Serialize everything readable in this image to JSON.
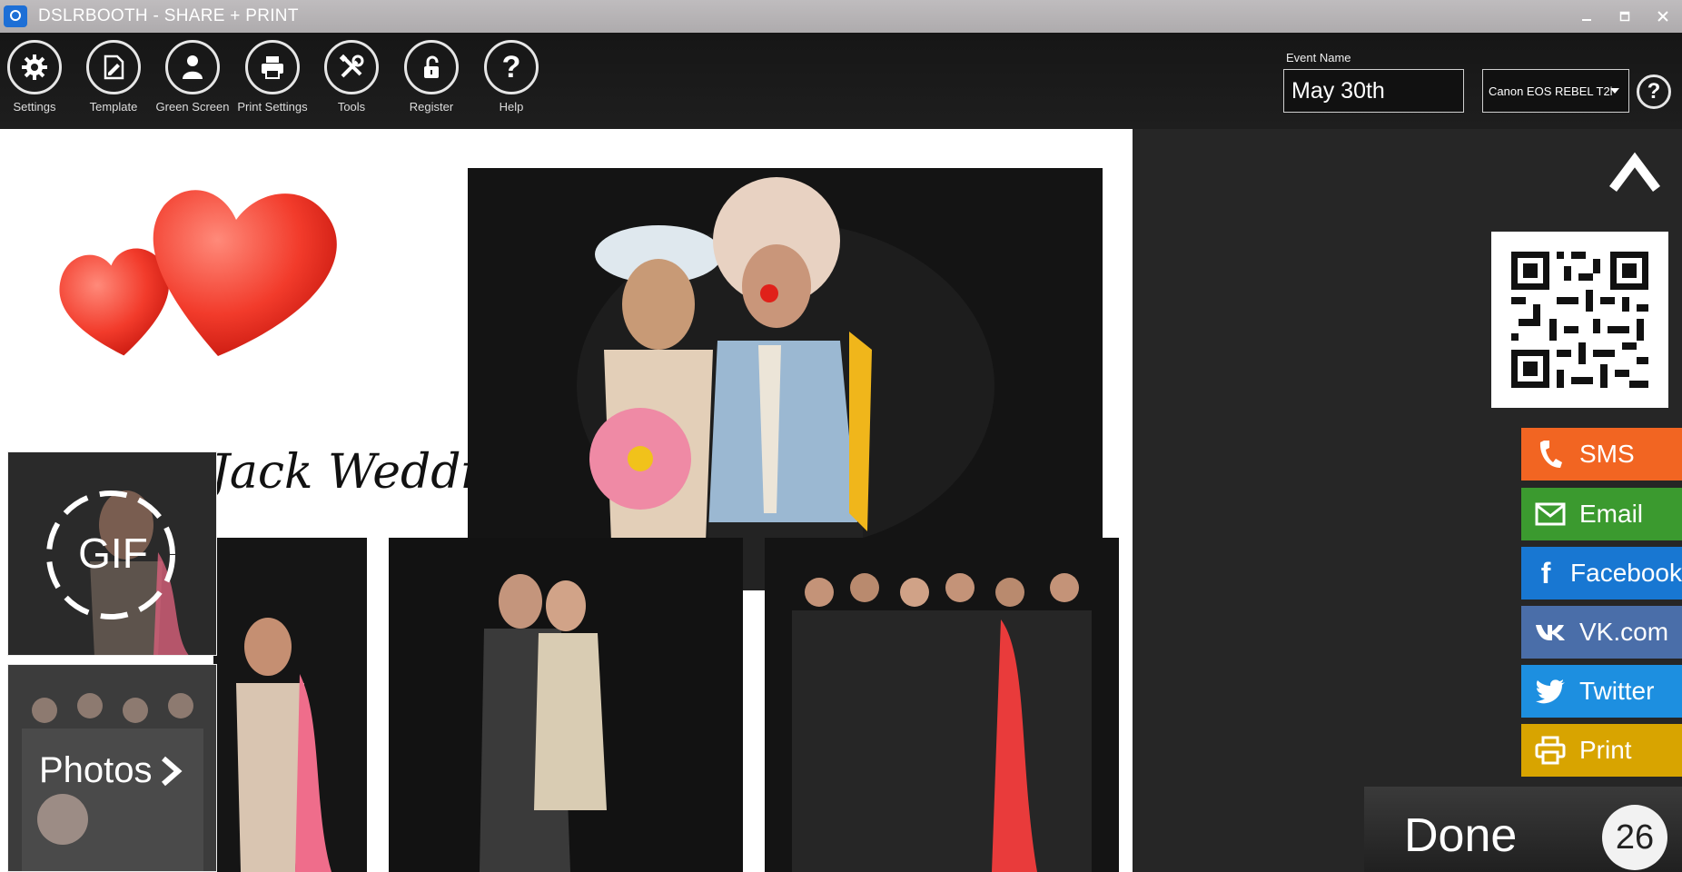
{
  "window": {
    "title": "DSLRBOOTH - SHARE + PRINT",
    "controls": [
      "minimize",
      "maximize",
      "close"
    ]
  },
  "toolbar": {
    "items": [
      {
        "label": "Settings",
        "icon": "gear-icon"
      },
      {
        "label": "Template",
        "icon": "template-icon"
      },
      {
        "label": "Green Screen",
        "icon": "person-icon"
      },
      {
        "label": "Print Settings",
        "icon": "printer-icon"
      },
      {
        "label": "Tools",
        "icon": "tools-icon"
      },
      {
        "label": "Register",
        "icon": "unlock-icon"
      },
      {
        "label": "Help",
        "icon": "help-icon"
      }
    ]
  },
  "event": {
    "label": "Event Name",
    "value": "May 30th"
  },
  "camera": {
    "selected": "Canon EOS REBEL T2i"
  },
  "template": {
    "wedding_text": "Jack Wedding"
  },
  "media_tiles": {
    "gif_label": "GIF",
    "photos_label": "Photos"
  },
  "share": {
    "buttons": [
      {
        "label": "SMS",
        "icon": "phone-icon",
        "color": "#f26522"
      },
      {
        "label": "Email",
        "icon": "mail-icon",
        "color": "#3b9a2f"
      },
      {
        "label": "Facebook",
        "icon": "facebook-icon",
        "color": "#1877d2"
      },
      {
        "label": "VK.com",
        "icon": "vk-icon",
        "color": "#4a6ea9"
      },
      {
        "label": "Twitter",
        "icon": "twitter-icon",
        "color": "#1d8fe0"
      },
      {
        "label": "Print",
        "icon": "printer-icon",
        "color": "#d8a400"
      }
    ]
  },
  "done": {
    "label": "Done",
    "countdown": "26"
  }
}
